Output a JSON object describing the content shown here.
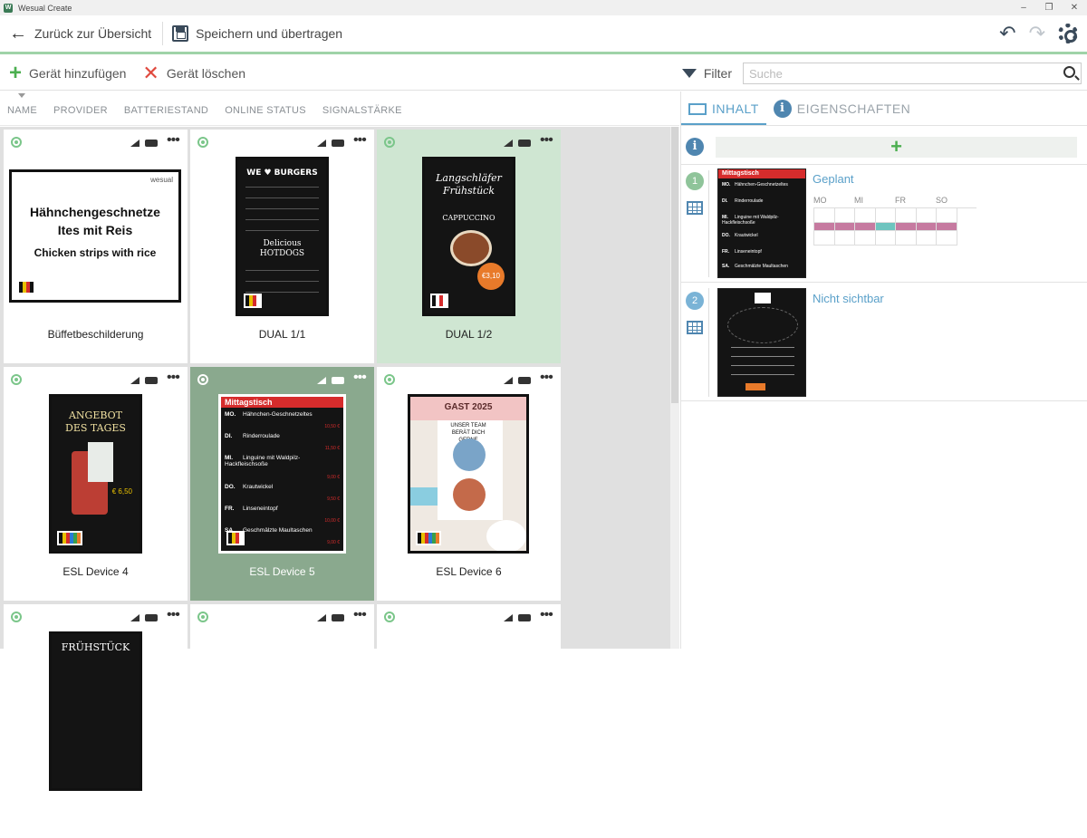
{
  "window": {
    "title": "Wesual Create"
  },
  "toolbar": {
    "back_label": "Zurück zur Übersicht",
    "save_label": "Speichern und übertragen"
  },
  "actions": {
    "add_label": "Gerät hinzufügen",
    "delete_label": "Gerät löschen",
    "filter_label": "Filter",
    "search_placeholder": "Suche"
  },
  "columns": [
    "NAME",
    "PROVIDER",
    "BATTERIESTAND",
    "ONLINE STATUS",
    "SIGNALSTÄRKE"
  ],
  "devices": [
    {
      "name": "Büffetbeschilderung",
      "screen_title": "Hähnchengeschnetze Ites mit Reis",
      "screen_subtitle": "Chicken strips with rice",
      "screen_logo": "wesual"
    },
    {
      "name": "DUAL 1/1",
      "screen_title": "WE ♥ BURGERS",
      "screen_subtitle": "Delicious HOTDOGS"
    },
    {
      "name": "DUAL 1/2",
      "screen_title": "Langschläfer Frühstück",
      "screen_subtitle": "CAPPUCCINO",
      "screen_price": "€3,10"
    },
    {
      "name": "ESL Device 4",
      "screen_title": "ANGEBOT DES TAGES",
      "screen_price": "€ 6,50"
    },
    {
      "name": "ESL Device 5",
      "screen_title": "Mittagstisch"
    },
    {
      "name": "ESL Device 6",
      "screen_title": "GAST 2025",
      "screen_subtitle": "UNSER TEAM BERÄT DICH GERNE"
    },
    {
      "name": "",
      "screen_title": "FRÜHSTÜCK"
    },
    {
      "name": ""
    },
    {
      "name": ""
    }
  ],
  "menu_items": [
    {
      "day": "MO.",
      "dish": "Hähnchen-Geschnetzeltes",
      "price": "10,50 €"
    },
    {
      "day": "DI.",
      "dish": "Rinderroulade",
      "price": "11,50 €"
    },
    {
      "day": "MI.",
      "dish": "Linguine mit Waldpilz-Hackfleischsoße",
      "price": "9,00 €"
    },
    {
      "day": "DO.",
      "dish": "Krautwickel",
      "price": "9,50 €"
    },
    {
      "day": "FR.",
      "dish": "Linseneintopf",
      "price": "10,00 €"
    },
    {
      "day": "SA.",
      "dish": "Geschmälzte Maultaschen",
      "price": "9,00 €"
    }
  ],
  "panel": {
    "tabs": [
      {
        "label": "INHALT",
        "icon": "screen-icon",
        "active": true
      },
      {
        "label": "EIGENSCHAFTEN",
        "icon": "info-icon",
        "active": false
      }
    ],
    "entries": [
      {
        "number": "1",
        "title": "Geplant",
        "thumb_title": "Mittagstisch",
        "color": "#8fc49a"
      },
      {
        "number": "2",
        "title": "Nicht sichtbar",
        "color": "#7ab3d6"
      }
    ],
    "schedule_days": [
      "MO",
      "MI",
      "FR",
      "SO"
    ]
  },
  "colors": {
    "accent_green": "#9fd3a8",
    "tab_blue": "#5aa0c9",
    "selected_light": "#cfe6d2",
    "selected_dark": "#8aa98e"
  }
}
